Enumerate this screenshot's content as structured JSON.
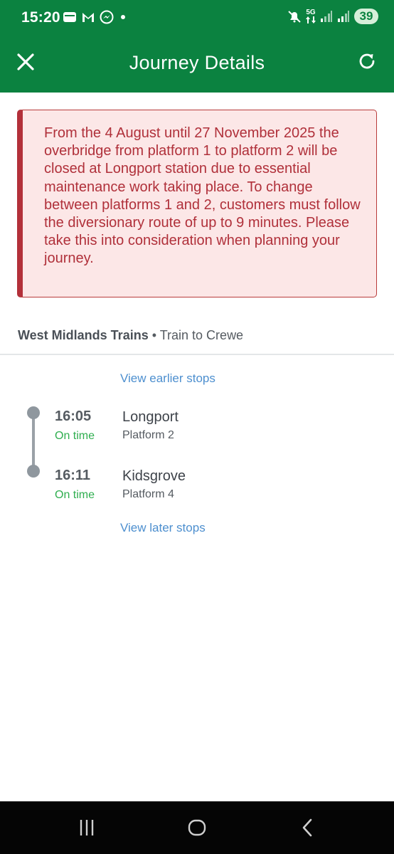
{
  "status_bar": {
    "time": "15:20",
    "network": "5G",
    "battery": "39"
  },
  "app_bar": {
    "title": "Journey Details"
  },
  "alert": {
    "message": "From the 4 August until 27 November 2025 the overbridge from platform 1 to platform 2 will be closed at Longport station due to essential maintenance work taking place. To change between platforms 1 and 2, customers must follow the diversionary route of up to 9 minutes. Please take this into consideration when planning your journey."
  },
  "service": {
    "operator": "West Midlands Trains",
    "separator": " • ",
    "destination": "Train to Crewe"
  },
  "links": {
    "earlier": "View earlier stops",
    "later": "View later stops"
  },
  "stops": [
    {
      "time": "16:05",
      "status": "On time",
      "name": "Longport",
      "platform": "Platform 2"
    },
    {
      "time": "16:11",
      "status": "On time",
      "name": "Kidsgrove",
      "platform": "Platform 4"
    }
  ],
  "colors": {
    "header_green": "#0b8240",
    "alert_red": "#b0303a",
    "on_time_green": "#2fae4f",
    "link_blue": "#4d8fcf"
  }
}
